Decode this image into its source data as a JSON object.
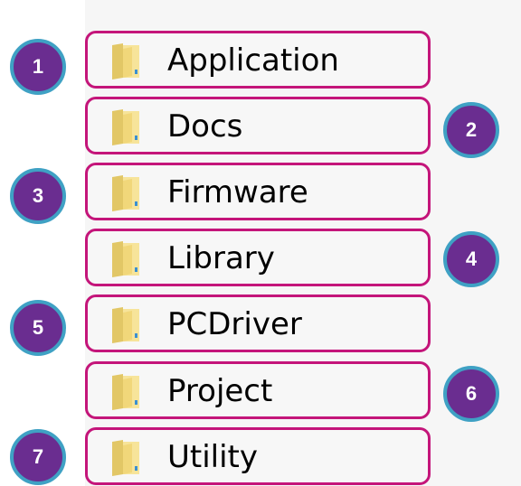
{
  "folders": [
    {
      "name": "Application",
      "number": "1"
    },
    {
      "name": "Docs",
      "number": "2"
    },
    {
      "name": "Firmware",
      "number": "3"
    },
    {
      "name": "Library",
      "number": "4"
    },
    {
      "name": "PCDriver",
      "number": "5"
    },
    {
      "name": "Project",
      "number": "6"
    },
    {
      "name": "Utility",
      "number": "7"
    }
  ],
  "icon": "folder-icon",
  "colors": {
    "row_border": "#c4157a",
    "badge_fill": "#6a2d90",
    "badge_ring": "#3fa1c4"
  }
}
